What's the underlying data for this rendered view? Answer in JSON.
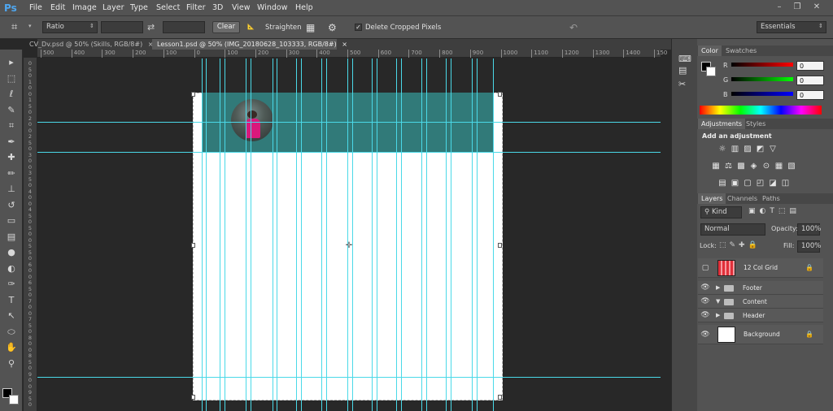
{
  "app": {
    "logo": "Ps"
  },
  "menu": [
    "File",
    "Edit",
    "Image",
    "Layer",
    "Type",
    "Select",
    "Filter",
    "3D",
    "View",
    "Window",
    "Help"
  ],
  "window_controls": {
    "minimize": "–",
    "restore": "❐",
    "close": "✕"
  },
  "options": {
    "ratio_select": "Ratio",
    "clear_label": "Clear",
    "straighten_label": "Straighten",
    "delete_cropped_label": "Delete Cropped Pixels",
    "workspace_select": "Essentials"
  },
  "tabs": [
    {
      "label": "CV_Dv.psd @ 50% (Skills, RGB/8#)",
      "close": "×"
    },
    {
      "label": "Lesson1.psd @ 50% (IMG_20180628_103333, RGB/8#)",
      "close": "×"
    }
  ],
  "ruler": {
    "top": [
      "500",
      "400",
      "300",
      "200",
      "100",
      "0",
      "100",
      "200",
      "300",
      "400",
      "500",
      "600",
      "700",
      "800",
      "900",
      "1000",
      "1100",
      "1200",
      "1300",
      "1400",
      "150"
    ],
    "left": [
      "0",
      "5",
      "0",
      "1",
      "0",
      "0",
      "1",
      "5",
      "0",
      "2",
      "0",
      "0",
      "2",
      "5",
      "0",
      "3",
      "0",
      "0",
      "3",
      "5",
      "0",
      "4",
      "0",
      "0",
      "4",
      "5",
      "0",
      "5",
      "0",
      "0",
      "5",
      "5",
      "0",
      "6",
      "0",
      "0",
      "6",
      "5",
      "0",
      "7",
      "0",
      "0",
      "7",
      "5",
      "0",
      "8",
      "0",
      "0",
      "8",
      "5",
      "0",
      "9",
      "0",
      "0",
      "9",
      "5",
      "0"
    ]
  },
  "tools": [
    {
      "name": "move-tool-icon",
      "glyph": "▸"
    },
    {
      "name": "marquee-tool-icon",
      "glyph": "⬚"
    },
    {
      "name": "lasso-tool-icon",
      "glyph": "ℓ"
    },
    {
      "name": "quick-select-tool-icon",
      "glyph": "✎"
    },
    {
      "name": "crop-tool-icon",
      "glyph": "⌗"
    },
    {
      "name": "eyedropper-tool-icon",
      "glyph": "✒"
    },
    {
      "name": "healing-brush-tool-icon",
      "glyph": "✚"
    },
    {
      "name": "brush-tool-icon",
      "glyph": "✏"
    },
    {
      "name": "clone-stamp-tool-icon",
      "glyph": "⊥"
    },
    {
      "name": "history-brush-tool-icon",
      "glyph": "↺"
    },
    {
      "name": "eraser-tool-icon",
      "glyph": "▭"
    },
    {
      "name": "gradient-tool-icon",
      "glyph": "▤"
    },
    {
      "name": "blur-tool-icon",
      "glyph": "●"
    },
    {
      "name": "dodge-tool-icon",
      "glyph": "◐"
    },
    {
      "name": "pen-tool-icon",
      "glyph": "✑"
    },
    {
      "name": "type-tool-icon",
      "glyph": "T"
    },
    {
      "name": "path-select-tool-icon",
      "glyph": "↖"
    },
    {
      "name": "shape-tool-icon",
      "glyph": "⬭"
    },
    {
      "name": "hand-tool-icon",
      "glyph": "✋"
    },
    {
      "name": "zoom-tool-icon",
      "glyph": "⚲"
    }
  ],
  "color_panel": {
    "tabs": [
      "Color",
      "Swatches"
    ],
    "r_label": "R",
    "g_label": "G",
    "b_label": "B",
    "r": "0",
    "g": "0",
    "b": "0"
  },
  "adjustments": {
    "tabs": [
      "Adjustments",
      "Styles"
    ],
    "title": "Add an adjustment"
  },
  "layers_panel": {
    "tabs": [
      "Layers",
      "Channels",
      "Paths"
    ],
    "kind": "Kind",
    "blend_mode": "Normal",
    "opacity_label": "Opacity:",
    "opacity": "100%",
    "lock_label": "Lock:",
    "fill_label": "Fill:",
    "fill": "100%",
    "layers": [
      {
        "name": "12 Col Grid",
        "type": "image"
      },
      {
        "name": "Footer",
        "type": "group"
      },
      {
        "name": "Content",
        "type": "group-open"
      },
      {
        "name": "Header",
        "type": "group"
      },
      {
        "name": "Background",
        "type": "background"
      }
    ]
  },
  "colors": {
    "guide": "#4ad9e8",
    "header_band": "#317a79",
    "accent_blue": "#4fa7f0"
  }
}
